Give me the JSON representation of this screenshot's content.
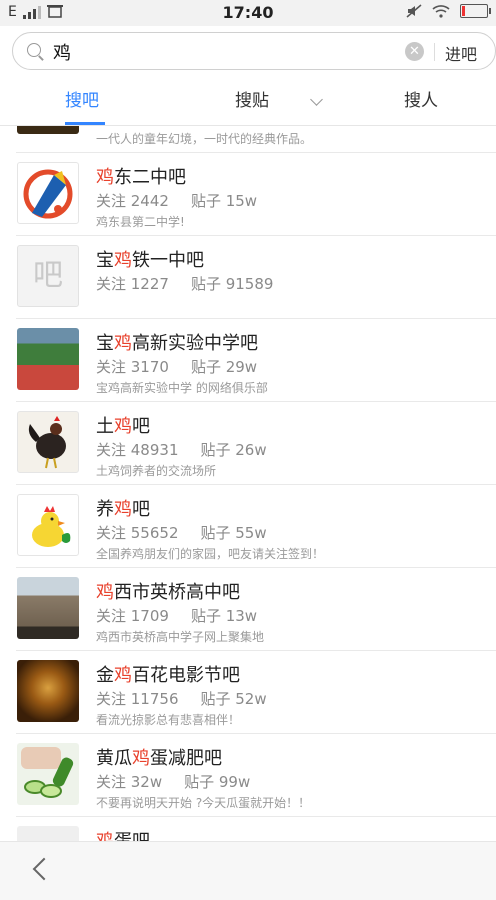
{
  "status": {
    "carrier": "E",
    "time": "17:40"
  },
  "search": {
    "value": "鸡",
    "enter_label": "进吧"
  },
  "tabs": [
    {
      "label": "搜吧"
    },
    {
      "label": "搜贴"
    },
    {
      "label": "搜人"
    }
  ],
  "top_partial": {
    "desc": "一代人的童年幻境，一时代的经典作品。"
  },
  "results": [
    {
      "pre": "",
      "hl": "鸡",
      "post": "东二中吧",
      "follow": "关注 2442",
      "posts": "贴子 15w",
      "desc": "鸡东县第二中学!"
    },
    {
      "pre": "宝",
      "hl": "鸡",
      "post": "铁一中吧",
      "follow": "关注 1227",
      "posts": "贴子 91589",
      "desc": "",
      "placeholder": "吧"
    },
    {
      "pre": "宝",
      "hl": "鸡",
      "post": "高新实验中学吧",
      "follow": "关注 3170",
      "posts": "贴子 29w",
      "desc": "宝鸡高新实验中学 的网络俱乐部"
    },
    {
      "pre": "土",
      "hl": "鸡",
      "post": "吧",
      "follow": "关注 48931",
      "posts": "贴子 26w",
      "desc": "土鸡饲养者的交流场所"
    },
    {
      "pre": "养",
      "hl": "鸡",
      "post": "吧",
      "follow": "关注 55652",
      "posts": "贴子 55w",
      "desc": "全国养鸡朋友们的家园，吧友请关注签到！"
    },
    {
      "pre": "",
      "hl": "鸡",
      "post": "西市英桥高中吧",
      "follow": "关注 1709",
      "posts": "贴子 13w",
      "desc": "鸡西市英桥高中学子网上聚集地"
    },
    {
      "pre": "金",
      "hl": "鸡",
      "post": "百花电影节吧",
      "follow": "关注 11756",
      "posts": "贴子 52w",
      "desc": "看流光掠影总有悲喜相伴！"
    },
    {
      "pre": "黄瓜",
      "hl": "鸡",
      "post": "蛋减肥吧",
      "follow": "关注 32w",
      "posts": "贴子 99w",
      "desc": "不要再说明天开始 ?今天瓜蛋就开始！！"
    },
    {
      "pre": "",
      "hl": "鸡",
      "post": "蛋吧",
      "follow": "",
      "posts": "",
      "desc": ""
    }
  ],
  "colors": {
    "accent": "#3385ff",
    "highlight": "#e8412c"
  }
}
